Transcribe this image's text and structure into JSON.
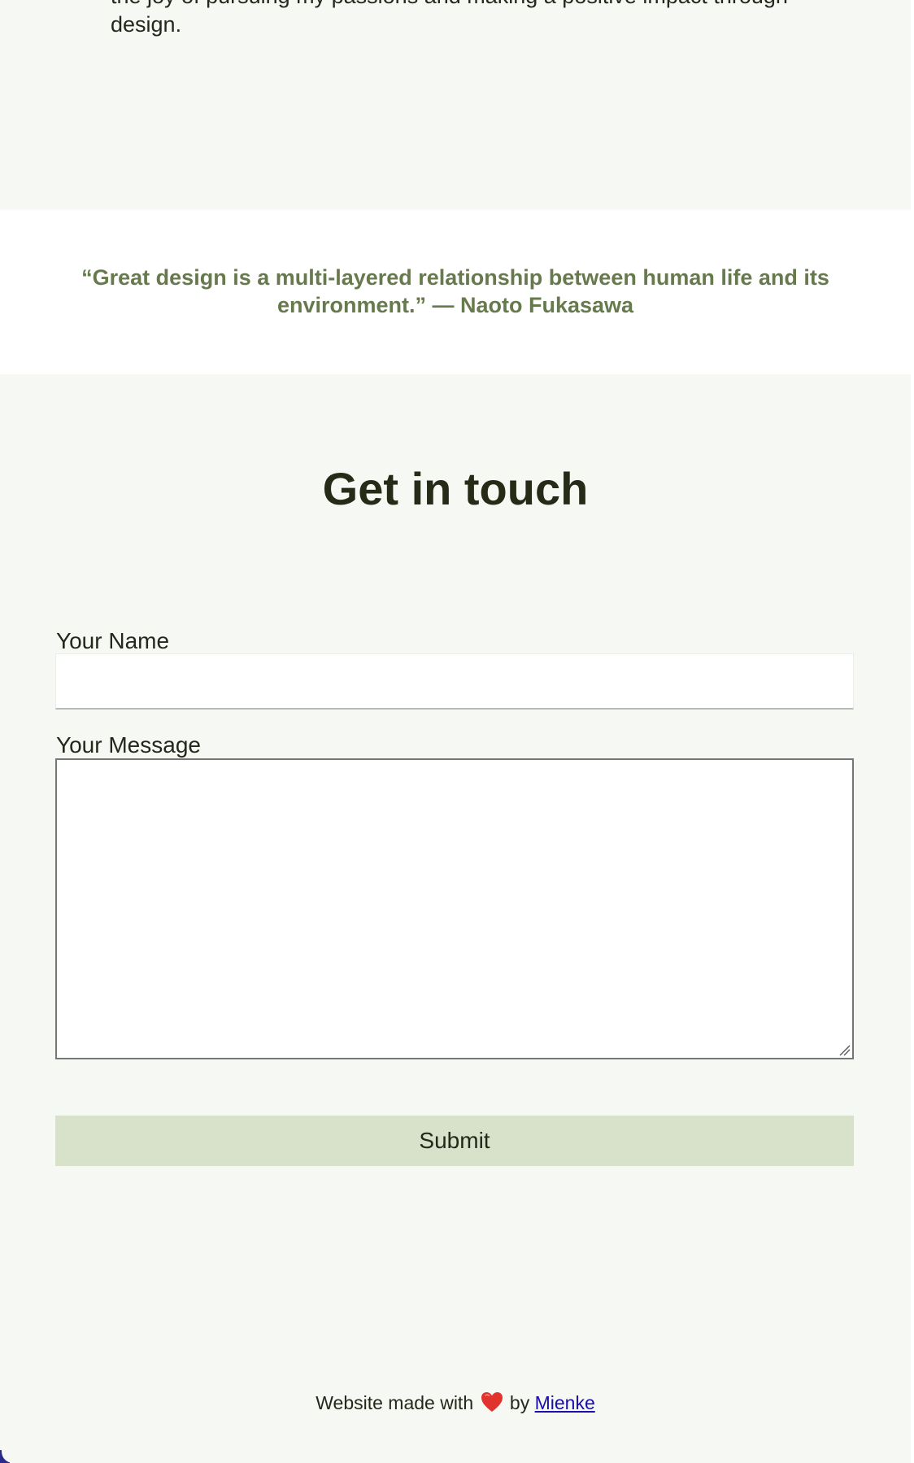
{
  "about": {
    "text": "the joy of pursuing my passions and making a positive impact through design."
  },
  "quote": {
    "text": "“Great design is a multi-layered relationship between human life and its environment.” — Naoto Fukasawa"
  },
  "contact": {
    "heading": "Get in touch",
    "name_label": "Your Name",
    "name_value": "",
    "message_label": "Your Message",
    "message_value": "",
    "submit_label": "Submit"
  },
  "footer": {
    "prefix": "Website made with",
    "heart_icon": "heart-icon",
    "by": "by",
    "author_link": "Mienke"
  },
  "colors": {
    "page_background": "#f6f8f3",
    "quote_band_background": "#ffffff",
    "quote_text": "#677a4d",
    "heading_text": "#262b18",
    "button_background": "#d8e1c9",
    "link": "#1a0dab",
    "heart": "#e0332e"
  }
}
